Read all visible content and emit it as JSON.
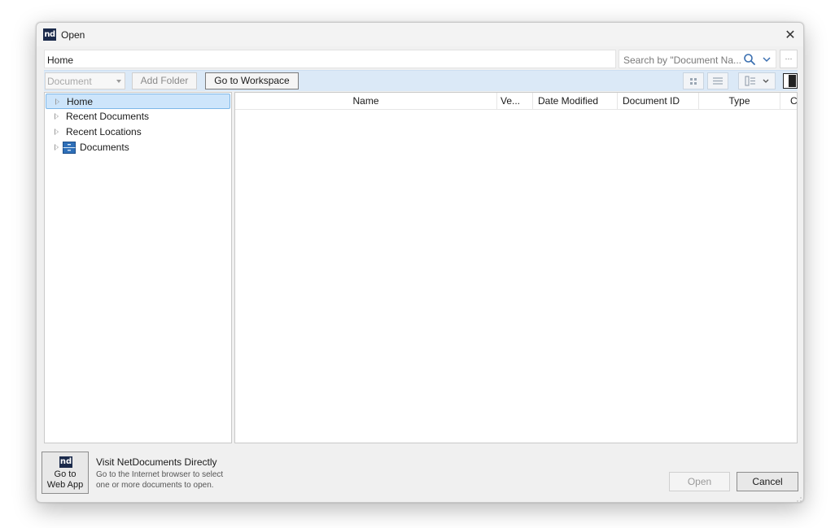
{
  "window": {
    "title": "Open",
    "logo_text": "nd",
    "close_glyph": "✕"
  },
  "path": {
    "value": "Home"
  },
  "search": {
    "placeholder": "Search by \"Document Na...",
    "more_glyph": "···"
  },
  "toolbar": {
    "document_select_value": "Document",
    "add_folder_label": "Add Folder",
    "go_to_workspace_label": "Go to Workspace"
  },
  "tree": {
    "items": [
      {
        "label": "Home",
        "selected": true
      },
      {
        "label": "Recent Documents"
      },
      {
        "label": "Recent Locations"
      },
      {
        "label": "Documents",
        "icon": "cabinet-icon"
      }
    ]
  },
  "list": {
    "columns": [
      {
        "label": "Name"
      },
      {
        "label": "Ve..."
      },
      {
        "label": "Date Modified"
      },
      {
        "label": "Document ID"
      },
      {
        "label": "Type"
      },
      {
        "label": "C"
      }
    ],
    "rows": []
  },
  "footer": {
    "webapp_logo_text": "nd",
    "webapp_label_line1": "Go to",
    "webapp_label_line2": "Web App",
    "visit_title": "Visit NetDocuments Directly",
    "visit_desc_line1": "Go to the Internet browser to select",
    "visit_desc_line2": "one or more documents to open.",
    "open_label": "Open",
    "cancel_label": "Cancel"
  },
  "colors": {
    "toolbar_bg": "#dbe9f7",
    "selection_bg": "#cde5fb",
    "selection_border": "#7db7e8",
    "logo_bg": "#1b2a4b"
  }
}
